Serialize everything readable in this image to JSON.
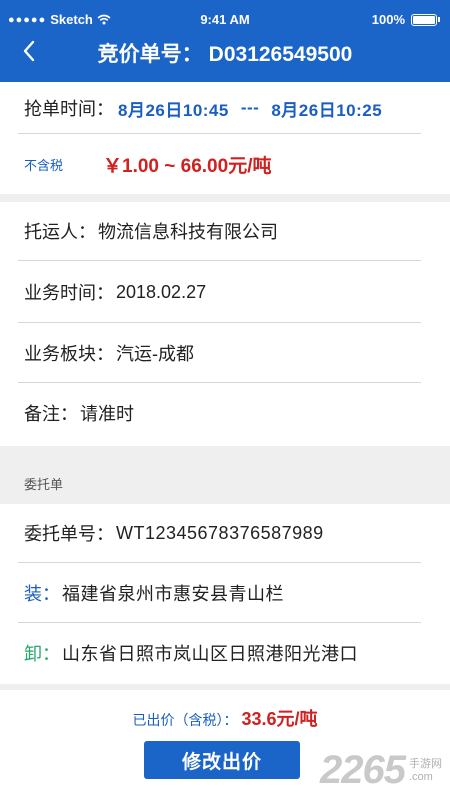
{
  "status_bar": {
    "carrier": "Sketch",
    "time": "9:41 AM",
    "battery": "100%"
  },
  "header": {
    "title_prefix": "竞价单号：",
    "order_no": "D03126549500"
  },
  "grab_time": {
    "label": "抢单时间：",
    "start": "8月26日10:45",
    "separator": "---",
    "end": "8月26日10:25"
  },
  "price": {
    "tax_label": "不含税",
    "range": "￥1.00 ~ 66.00元/吨"
  },
  "details": {
    "shipper": {
      "label": "托运人：",
      "value": "物流信息科技有限公司"
    },
    "biz_time": {
      "label": "业务时间：",
      "value": "2018.02.27"
    },
    "biz_segment": {
      "label": "业务板块：",
      "value": "汽运-成都"
    },
    "note": {
      "label": "备注：",
      "value": "请准时"
    }
  },
  "consignment": {
    "section_title": "委托单",
    "number": {
      "label": "委托单号：",
      "value": "WT12345678376587989"
    },
    "load": {
      "label": "装：",
      "value": "福建省泉州市惠安县青山栏"
    },
    "unload": {
      "label": "卸：",
      "value": "山东省日照市岚山区日照港阳光港口"
    }
  },
  "bid": {
    "label": "已出价（含税）：",
    "value": "33.6元/吨"
  },
  "action": {
    "modify_label": "修改出价"
  },
  "watermark": {
    "brand_num": "2265",
    "brand_suffix": ".com",
    "brand_text": "手游网"
  }
}
